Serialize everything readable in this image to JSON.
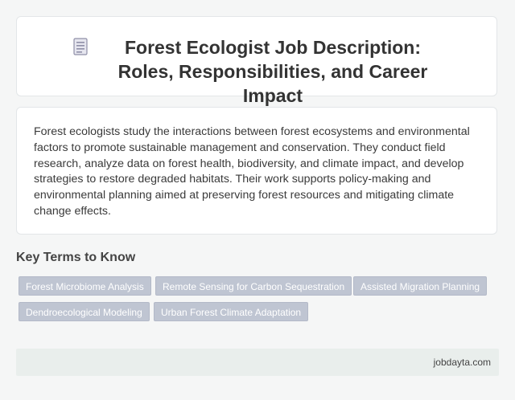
{
  "header": {
    "icon": "document-icon",
    "title": "Forest Ecologist Job Description: Roles, Responsibilities, and Career Impact"
  },
  "description": "Forest ecologists study the interactions between forest ecosystems and environmental factors to promote sustainable management and conservation. They conduct field research, analyze data on forest health, biodiversity, and climate impact, and develop strategies to restore degraded habitats. Their work supports policy-making and environmental planning aimed at preserving forest resources and mitigating climate change effects.",
  "key_terms": {
    "title": "Key Terms to Know",
    "tags": [
      "Forest Microbiome Analysis",
      "Remote Sensing for Carbon Sequestration",
      "Assisted Migration Planning",
      "Dendroecological Modeling",
      "Urban Forest Climate Adaptation"
    ]
  },
  "footer": {
    "site": "jobdayta.com"
  }
}
